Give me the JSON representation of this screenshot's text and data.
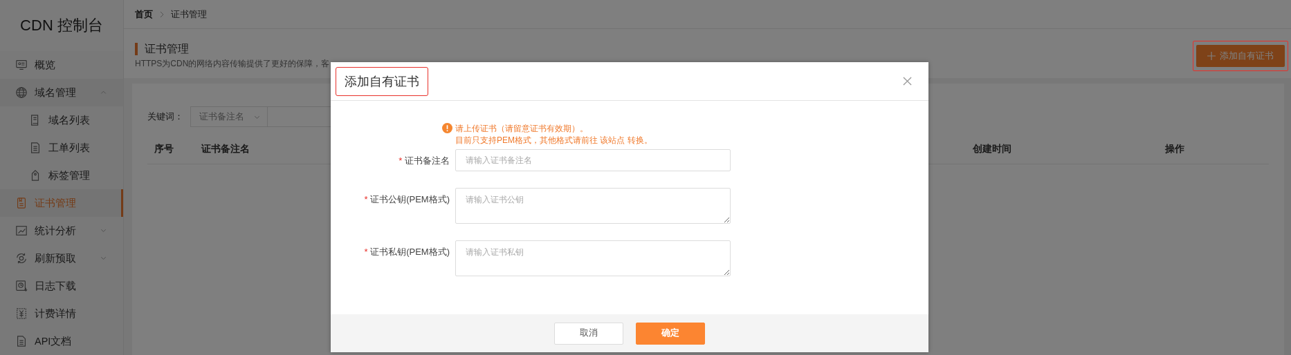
{
  "sidebar": {
    "logo": "CDN 控制台",
    "items": [
      {
        "label": "概览",
        "kind": "item",
        "selected": false
      },
      {
        "label": "域名管理",
        "kind": "group",
        "selected": false,
        "expanded": true,
        "children": [
          {
            "label": "域名列表",
            "selected": false
          },
          {
            "label": "工单列表",
            "selected": false
          },
          {
            "label": "标签管理",
            "selected": false
          }
        ]
      },
      {
        "label": "证书管理",
        "kind": "item",
        "selected": true
      },
      {
        "label": "统计分析",
        "kind": "group",
        "selected": false,
        "expanded": false
      },
      {
        "label": "刷新预取",
        "kind": "group",
        "selected": false,
        "expanded": false
      },
      {
        "label": "日志下载",
        "kind": "item",
        "selected": false
      },
      {
        "label": "计费详情",
        "kind": "item",
        "selected": false
      },
      {
        "label": "API文档",
        "kind": "item",
        "selected": false
      }
    ]
  },
  "breadcrumb": [
    {
      "label": "首页",
      "current": false
    },
    {
      "label": "证书管理",
      "current": true
    }
  ],
  "page_header": {
    "title": "证书管理",
    "description": "HTTPS为CDN的网络内容传输提供了更好的保障，客",
    "add_button": {
      "label": "添加自有证书",
      "highlighted": true
    }
  },
  "filter": {
    "label": "关键词：",
    "select": "证书备注名"
  },
  "table": {
    "columns": [
      "序号",
      "证书备注名",
      "创建时间",
      "操作"
    ]
  },
  "modal": {
    "title": "添加自有证书",
    "title_highlighted": true,
    "required_mark": "*",
    "notice": [
      "请上传证书（请留意证书有效期）。",
      "目前只支持PEM格式，其他格式请前往 该站点 转换。"
    ],
    "fields": [
      {
        "label": "证书备注名",
        "required": true,
        "kind": "input",
        "placeholder": "请输入证书备注名"
      },
      {
        "label": "证书公钥(PEM格式)",
        "required": true,
        "kind": "textarea",
        "placeholder": "请输入证书公钥"
      },
      {
        "label": "证书私钥(PEM格式)",
        "required": true,
        "kind": "textarea",
        "placeholder": "请输入证书私钥"
      }
    ],
    "buttons": [
      {
        "label": "取消",
        "kind": "secondary"
      },
      {
        "label": "确定",
        "kind": "primary"
      }
    ]
  }
}
